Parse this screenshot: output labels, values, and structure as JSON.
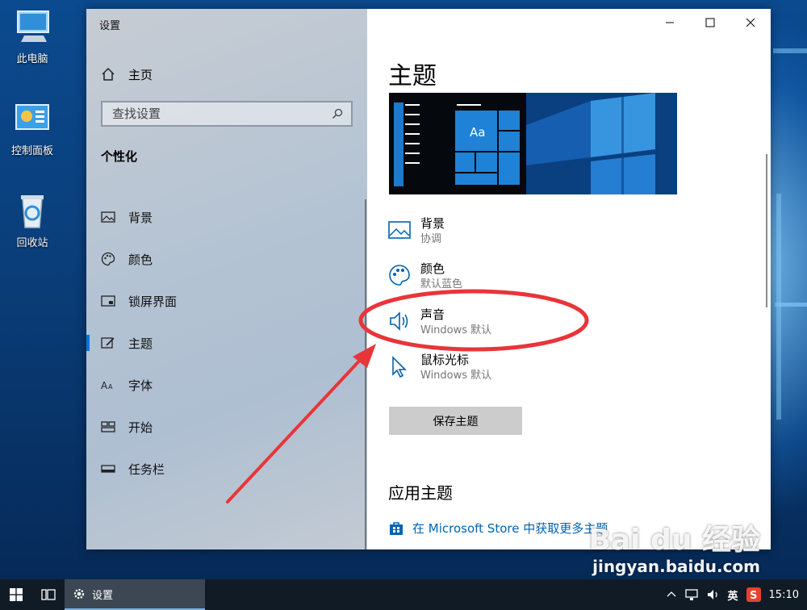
{
  "desktop": {
    "icons": [
      {
        "label": "此电脑",
        "icon": "this-pc-icon"
      },
      {
        "label": "控制面板",
        "icon": "control-panel-icon"
      },
      {
        "label": "回收站",
        "icon": "recycle-bin-icon"
      }
    ]
  },
  "window": {
    "app_title": "设置",
    "nav": {
      "home_label": "主页",
      "search_placeholder": "查找设置",
      "section_title": "个性化",
      "items": [
        {
          "label": "背景",
          "icon": "picture-icon",
          "active": false
        },
        {
          "label": "颜色",
          "icon": "palette-icon",
          "active": false
        },
        {
          "label": "锁屏界面",
          "icon": "lock-screen-icon",
          "active": false
        },
        {
          "label": "主题",
          "icon": "theme-brush-icon",
          "active": true
        },
        {
          "label": "字体",
          "icon": "font-icon",
          "active": false
        },
        {
          "label": "开始",
          "icon": "start-tiles-icon",
          "active": false
        },
        {
          "label": "任务栏",
          "icon": "taskbar-icon",
          "active": false
        }
      ]
    },
    "content": {
      "title": "主题",
      "preview_sample_text": "Aa",
      "theme_items": [
        {
          "title": "背景",
          "subtitle": "协调",
          "icon": "picture-icon"
        },
        {
          "title": "颜色",
          "subtitle": "默认蓝色",
          "icon": "palette-icon"
        },
        {
          "title": "声音",
          "subtitle": "Windows 默认",
          "icon": "speaker-icon"
        },
        {
          "title": "鼠标光标",
          "subtitle": "Windows 默认",
          "icon": "cursor-icon"
        }
      ],
      "save_button": "保存主题",
      "apply_heading": "应用主题",
      "store_link": "在 Microsoft Store 中获取更多主题"
    }
  },
  "taskbar": {
    "app_label": "设置",
    "ime": "英",
    "clock": "15:10"
  },
  "watermark": {
    "logo": "Bai du 经验",
    "url": "jingyan.baidu.com"
  },
  "colors": {
    "accent": "#0078d7",
    "link": "#0063b1",
    "annotation": "#e8353a"
  }
}
